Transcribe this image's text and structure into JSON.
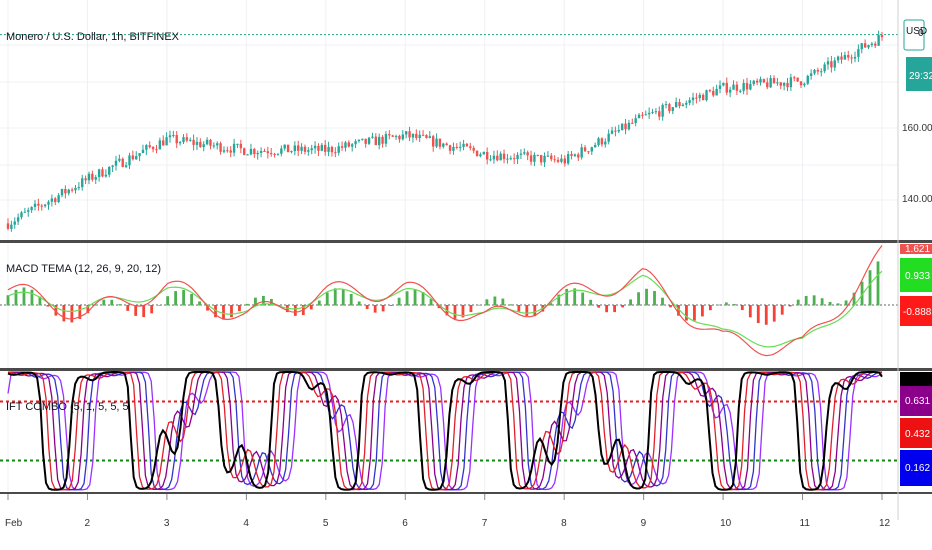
{
  "colors": {
    "up": "#26a69a",
    "down": "#ef5350",
    "macd": "#ef5350",
    "signal": "#66dd55",
    "hist_pos": "#4caf50",
    "hist_neg": "#f44336",
    "ift1": "#000000",
    "ift2": "#e0202a",
    "ift3": "#8b008b",
    "ift4": "#3333cc",
    "ift5": "#9b30ff",
    "upper_level": "#e02020",
    "lower_level": "#118811",
    "price_line": "#1aa880"
  },
  "price_pane": {
    "title": "Monero / U.S. Dollar, 1h, BITFINEX",
    "currency": "USD",
    "last_price_label": "0",
    "countdown": "29:32",
    "axis_labels": [
      "160.000",
      "140.000"
    ]
  },
  "macd_pane": {
    "title": "MACD TEMA (12, 26, 9, 20, 12)",
    "badges": [
      {
        "value": "1.621",
        "color": "#ef5350"
      },
      {
        "value": "0.933",
        "color": "#22dd22"
      },
      {
        "value": "-0.888",
        "color": "#ff1a1a"
      }
    ]
  },
  "ift_pane": {
    "title": "IFT COMBO (5, 1, 5, 5, 5",
    "badges": [
      {
        "value": "",
        "color": "#000000"
      },
      {
        "value": "0.631",
        "color": "#8b008b"
      },
      {
        "value": "0.432",
        "color": "#ee1111"
      },
      {
        "value": "0.162",
        "color": "#0000ee"
      }
    ],
    "upper_level": 0.432,
    "lower_level": 0.162
  },
  "time_axis": [
    "Feb",
    "2",
    "3",
    "4",
    "5",
    "6",
    "7",
    "8",
    "9",
    "10",
    "11",
    "12"
  ],
  "chart_data": [
    {
      "type": "candlestick",
      "title": "Monero / U.S. Dollar, 1h, BITFINEX",
      "x": [
        "Feb",
        "2",
        "3",
        "4",
        "5",
        "6",
        "7",
        "8",
        "9",
        "10",
        "11",
        "12"
      ],
      "close_approx": [
        131,
        143,
        154,
        151,
        151,
        155,
        150,
        148,
        160,
        168,
        170,
        182
      ],
      "y_ticks": [
        140,
        160
      ],
      "ylim": [
        127,
        192
      ],
      "grid": true
    },
    {
      "type": "line",
      "title": "MACD TEMA (12, 26, 9, 20, 12)",
      "x": [
        "Feb",
        "2",
        "3",
        "4",
        "5",
        "6",
        "7",
        "8",
        "9",
        "10",
        "11",
        "12"
      ],
      "series": [
        {
          "name": "MACD",
          "values": [
            0.5,
            -0.3,
            0.6,
            -0.4,
            0.4,
            0.5,
            -0.5,
            0.3,
            0.9,
            -1.2,
            -1.4,
            1.6
          ]
        },
        {
          "name": "Signal",
          "values": [
            0.3,
            -0.1,
            0.5,
            -0.3,
            0.3,
            0.4,
            -0.4,
            0.2,
            0.8,
            -1.0,
            -1.3,
            0.9
          ]
        }
      ],
      "last_values": [
        1.621,
        0.933,
        -0.888
      ],
      "ylim": [
        -2,
        2
      ]
    },
    {
      "type": "line",
      "title": "IFT COMBO (5, 1, 5, 5, 5",
      "x": [
        "Feb",
        "2",
        "3",
        "4",
        "5",
        "6",
        "7",
        "8",
        "9",
        "10",
        "11",
        "12"
      ],
      "levels": [
        0.432,
        0.162
      ],
      "last_values": [
        0.631,
        0.432,
        0.162
      ],
      "ylim": [
        0,
        1
      ]
    }
  ]
}
